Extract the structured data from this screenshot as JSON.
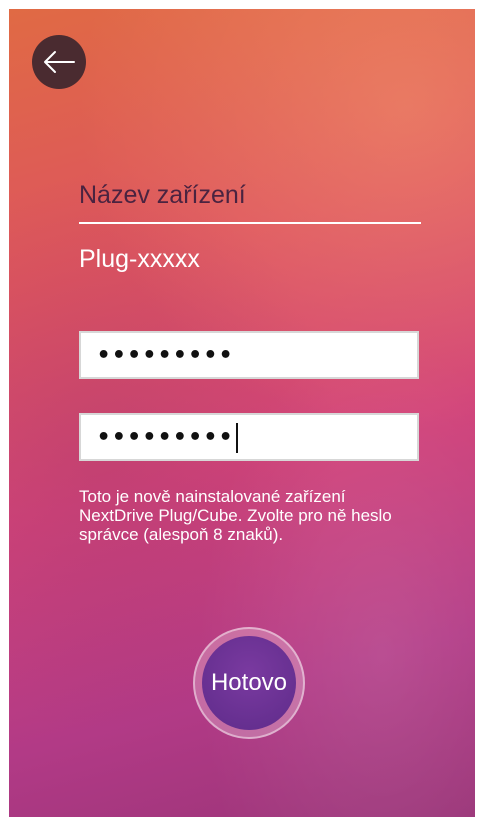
{
  "header": {
    "back_icon": "arrow-left-icon"
  },
  "device": {
    "label": "Název zařízení",
    "name": "Plug-xxxxx"
  },
  "password": {
    "value": "•••••••••",
    "confirm_value": "•••••••••"
  },
  "help": {
    "text": "Toto je nově nainstalované zařízení NextDrive Plug/Cube. Zvolte pro ně heslo správce (alespoň 8 znaků)."
  },
  "actions": {
    "done_label": "Hotovo"
  },
  "colors": {
    "gradient_top": "#e06a44",
    "gradient_bottom": "#9a3478",
    "button": "#5e2b8a",
    "back_button": "#4a2b30"
  }
}
